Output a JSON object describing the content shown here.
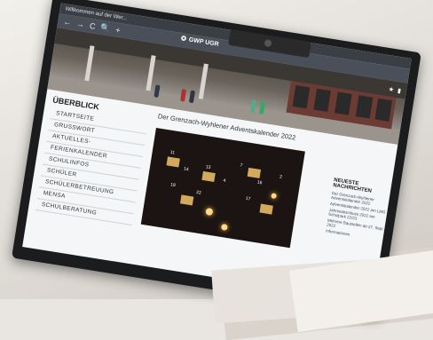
{
  "browser": {
    "tab_title": "Willkommen auf der Wer...",
    "nav": [
      "←",
      "→",
      "C",
      "🔍",
      "+"
    ]
  },
  "site": {
    "name": "GWP UGR"
  },
  "sidebar": {
    "title": "ÜBERBLICK",
    "items": [
      {
        "label": "STARTSEITE"
      },
      {
        "label": "GRUSSWORT"
      },
      {
        "label": "AKTUELLES-"
      },
      {
        "label": "FERIENKALENDER"
      },
      {
        "label": "SCHULINFOS"
      },
      {
        "label": "SCHÜLER"
      },
      {
        "label": "SCHÜLERBETREUUNG"
      },
      {
        "label": "MENSA"
      },
      {
        "label": "SCHULBERATUNG"
      }
    ]
  },
  "main": {
    "title": "Der Grenzach-Wyhlener Adventskalender 2022",
    "calendar_numbers": [
      "11",
      "14",
      "13",
      "4",
      "7",
      "16",
      "18",
      "22",
      "17",
      "2"
    ]
  },
  "news": {
    "title": "NEUESTE NACHRICHTEN",
    "items": [
      "Der Grenzach-Wyhlener Adventskalender 2022",
      "Adventskalender 2022 am LMG",
      "Jahresabschluss 2022 am Schulpark 22/23",
      "Mehrere Baustellen ab 27. Sept. 2022",
      "Informationen"
    ]
  }
}
